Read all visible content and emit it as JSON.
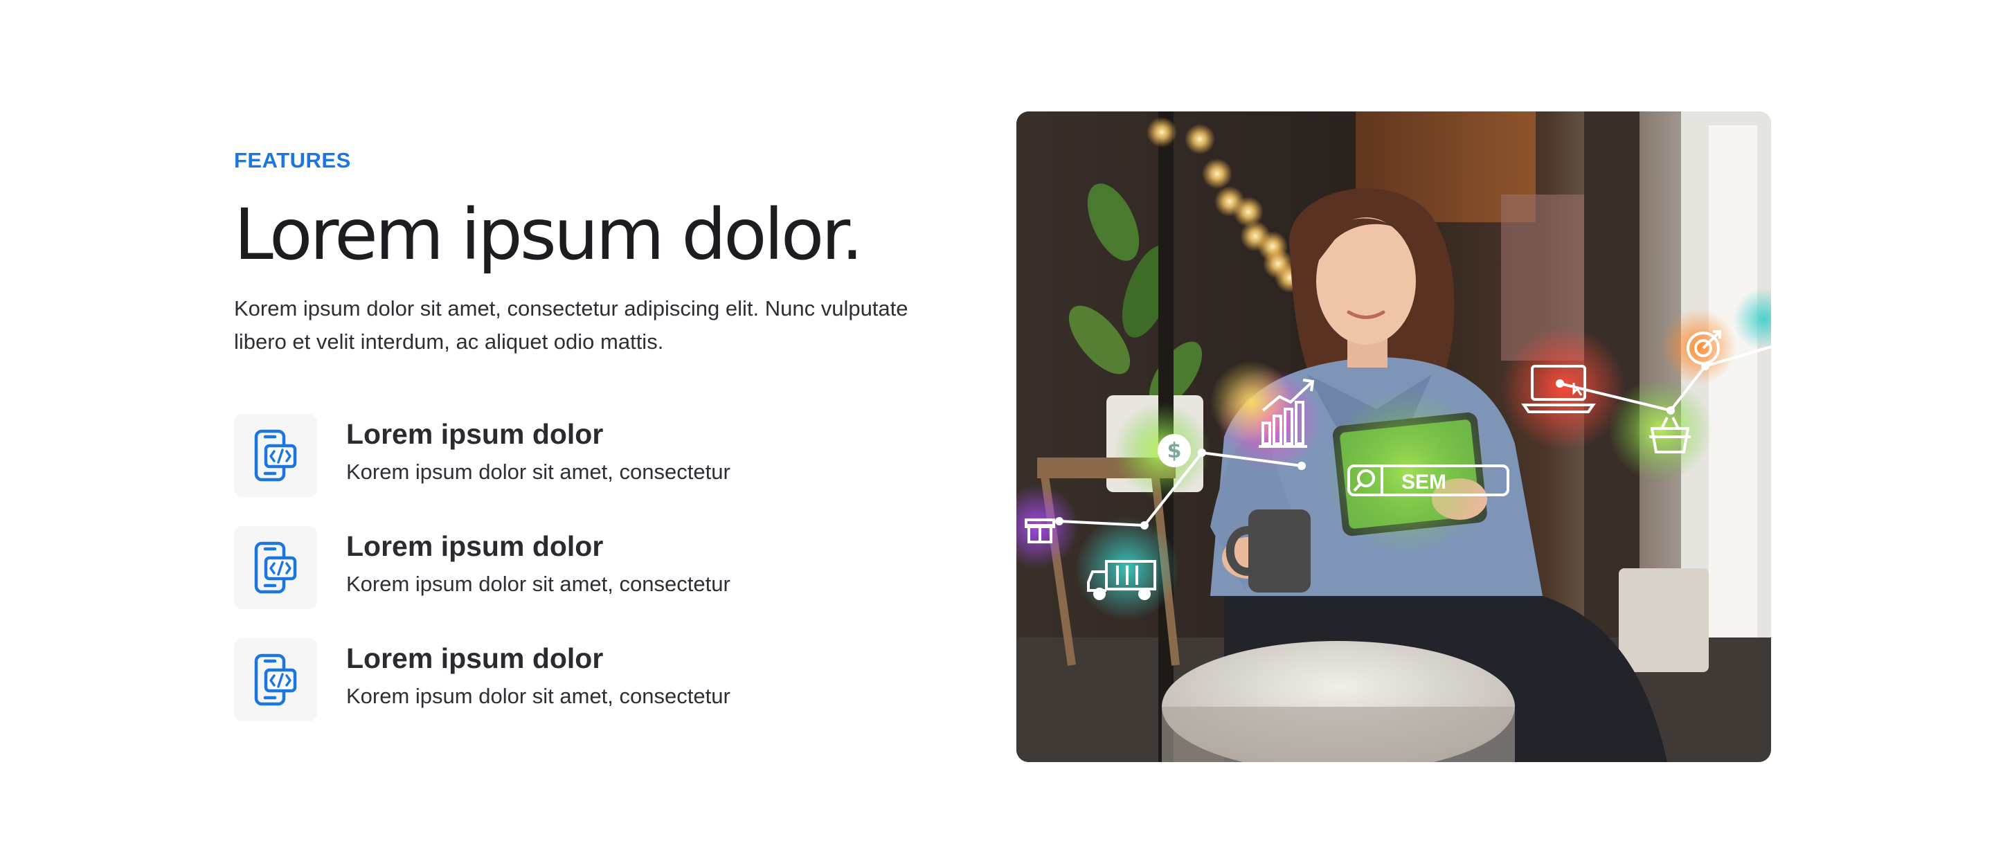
{
  "colors": {
    "accent": "#1b76e0",
    "icon_tile": "#f6f6f7",
    "heading": "#1c1d21",
    "body_text": "#2b2f36"
  },
  "features_section": {
    "eyebrow": "FEATURES",
    "headline": "Lorem ipsum dolor.",
    "lead": "Korem ipsum dolor sit amet, consectetur adipiscing elit. Nunc vulputate libero et velit interdum, ac aliquet odio mattis.",
    "items": [
      {
        "icon": "mobile-code-icon",
        "title": "Lorem ipsum dolor",
        "description": "Korem ipsum dolor sit amet, consectetur"
      },
      {
        "icon": "mobile-code-icon",
        "title": "Lorem ipsum dolor",
        "description": "Korem ipsum dolor sit amet, consectetur"
      },
      {
        "icon": "mobile-code-icon",
        "title": "Lorem ipsum dolor",
        "description": "Korem ipsum dolor sit amet, consectetur"
      }
    ]
  },
  "hero_image": {
    "overlay_label": "SEM",
    "overlay_icons": [
      "gift-icon",
      "truck-icon",
      "dollar-icon",
      "bar-chart-icon",
      "search-icon",
      "laptop-icon",
      "cart-icon",
      "target-icon"
    ]
  }
}
